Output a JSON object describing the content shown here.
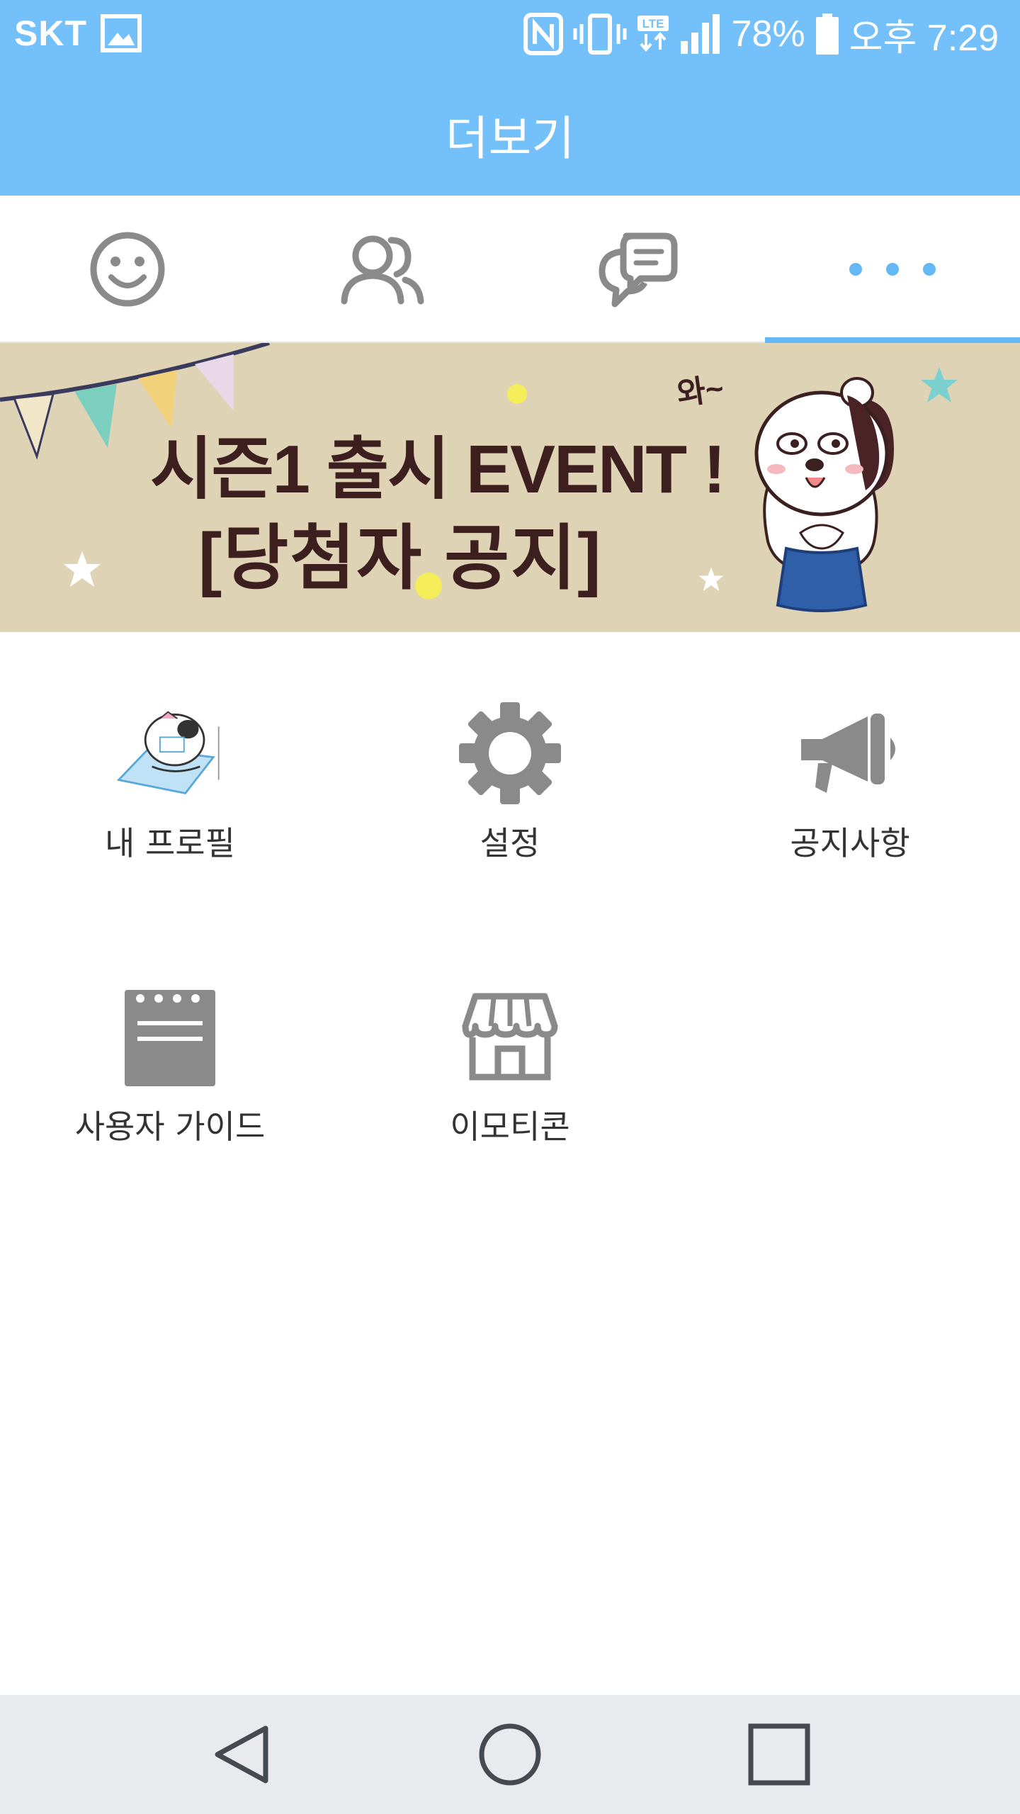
{
  "status_bar": {
    "carrier": "SKT",
    "battery": "78%",
    "time": "오후 7:29",
    "icons": [
      "gallery-icon",
      "nfc-icon",
      "vibrate-icon",
      "lte-icon",
      "signal-icon",
      "battery-icon"
    ]
  },
  "app_bar": {
    "title": "더보기"
  },
  "tabs": [
    {
      "name": "emoticon",
      "icon": "smiley-icon"
    },
    {
      "name": "friends",
      "icon": "people-icon"
    },
    {
      "name": "chat",
      "icon": "chat-bubbles-icon"
    },
    {
      "name": "more",
      "icon": "more-dots-icon",
      "active": true
    }
  ],
  "banner": {
    "exclaim": "와~",
    "line1": "시즌1 출시 EVENT !",
    "line2": "[당첨자 공지]"
  },
  "menu": {
    "profile": "내 프로필",
    "settings": "설정",
    "notice": "공지사항",
    "guide": "사용자 가이드",
    "emoticon_shop": "이모티콘"
  },
  "colors": {
    "primary": "#74c0fa",
    "accent": "#64b9f4",
    "icon_gray": "#8a8a8a",
    "banner_bg": "#dfd3b6",
    "banner_text": "#3e1f1f",
    "nav_bg": "#e9eaee"
  }
}
